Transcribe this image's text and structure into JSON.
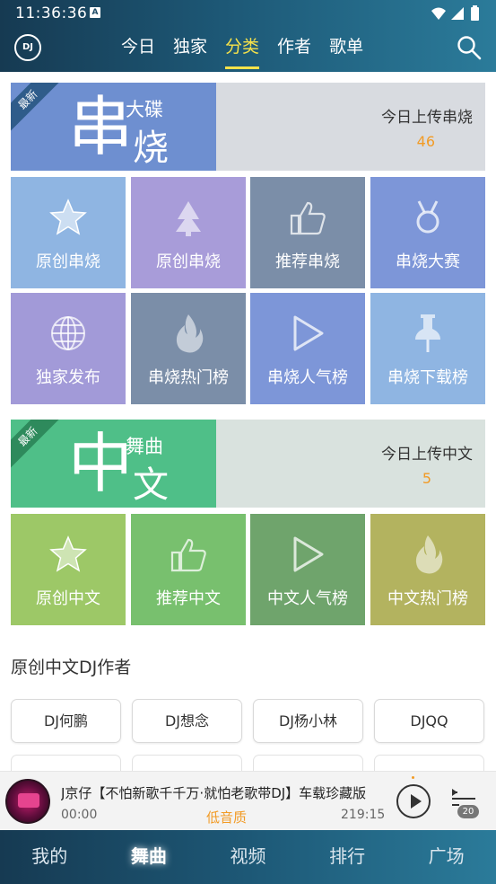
{
  "status": {
    "time": "11:36:36",
    "badge": "A"
  },
  "header": {
    "logo": "DJ",
    "tabs": [
      {
        "label": "今日",
        "active": false
      },
      {
        "label": "独家",
        "active": false
      },
      {
        "label": "分类",
        "active": true
      },
      {
        "label": "作者",
        "active": false
      },
      {
        "label": "歌单",
        "active": false
      }
    ]
  },
  "banner1": {
    "ribbon": "最新",
    "big_char": "串",
    "small_text": "大碟",
    "big_text2": "烧",
    "today_label": "今日上传串烧",
    "count": "46",
    "color": "#6e8fd0"
  },
  "grid1": [
    {
      "label": "原创串烧",
      "icon": "star-icon",
      "color": "#8fb5e2"
    },
    {
      "label": "原创串烧",
      "icon": "tree-icon",
      "color": "#a89cd9"
    },
    {
      "label": "推荐串烧",
      "icon": "thumbs-up-icon",
      "color": "#7b8ea8"
    },
    {
      "label": "串烧大赛",
      "icon": "medal-icon",
      "color": "#7d96d8"
    },
    {
      "label": "独家发布",
      "icon": "globe-icon",
      "color": "#a29ad8"
    },
    {
      "label": "串烧热门榜",
      "icon": "flame-icon",
      "color": "#7b8ea8"
    },
    {
      "label": "串烧人气榜",
      "icon": "play-triangle-icon",
      "color": "#7d96d8"
    },
    {
      "label": "串烧下载榜",
      "icon": "pin-icon",
      "color": "#8fb5e2"
    }
  ],
  "banner2": {
    "ribbon": "最新",
    "big_char": "中",
    "small_text": "舞曲",
    "big_text2": "文",
    "today_label": "今日上传中文",
    "count": "5",
    "color": "#4fbf88"
  },
  "grid2": [
    {
      "label": "原创中文",
      "icon": "star-icon",
      "color": "#9dc867"
    },
    {
      "label": "推荐中文",
      "icon": "thumbs-up-icon",
      "color": "#78c06e"
    },
    {
      "label": "中文人气榜",
      "icon": "play-triangle-icon",
      "color": "#6fa46c"
    },
    {
      "label": "中文热门榜",
      "icon": "flame-icon",
      "color": "#b3b35f"
    }
  ],
  "authors_section": {
    "title": "原创中文DJ作者",
    "authors": [
      "DJ何鹏",
      "DJ想念",
      "DJ杨小林",
      "DJQQ"
    ]
  },
  "player": {
    "song": "J京仔【不怕新歌千千万·就怕老歌带DJ】车载珍藏版",
    "time_current": "00:00",
    "quality": "低音质",
    "time_total": "219:15",
    "playlist_count": "20"
  },
  "bottom_nav": [
    {
      "label": "我的",
      "active": false
    },
    {
      "label": "舞曲",
      "active": true
    },
    {
      "label": "视频",
      "active": false
    },
    {
      "label": "排行",
      "active": false
    },
    {
      "label": "广场",
      "active": false
    }
  ]
}
